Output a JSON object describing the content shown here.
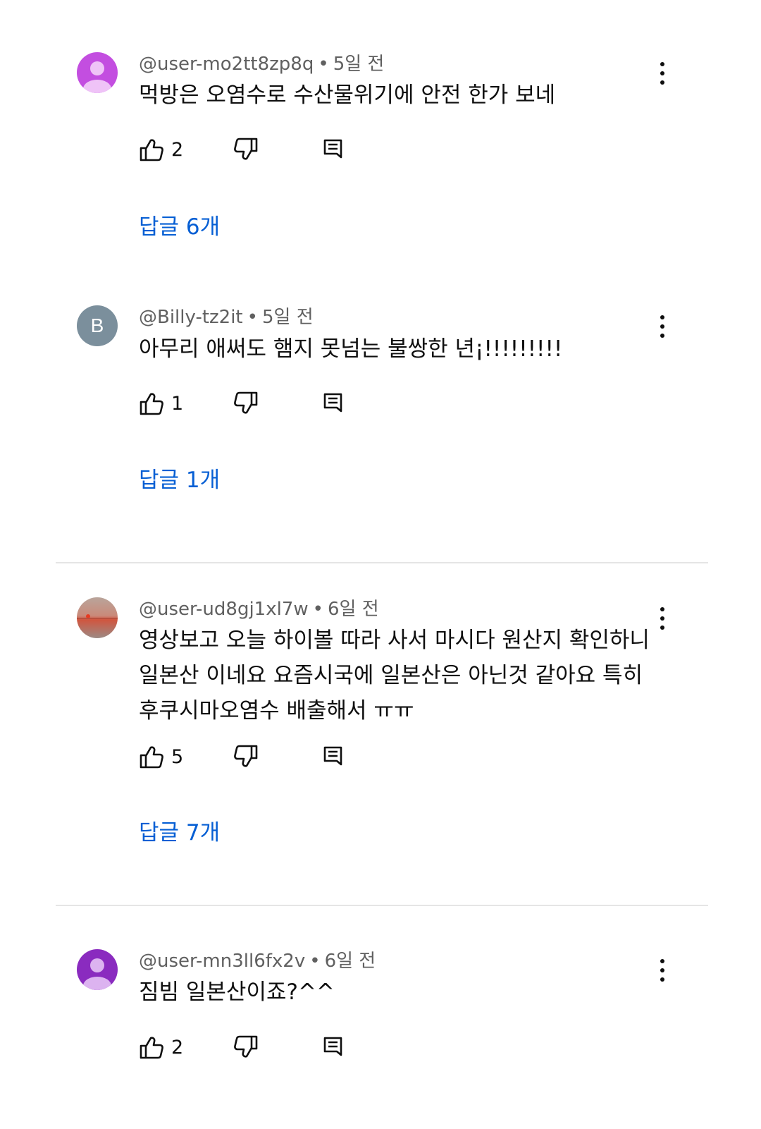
{
  "comments": [
    {
      "author": "@user-mo2tt8zp8q",
      "time": "5일 전",
      "text": "먹방은 오염수로 수산물위기에 안전 한가 보네",
      "likes": "2",
      "replies": "답글 6개",
      "avatar_color": "#c34ee0"
    },
    {
      "author": "@Billy-tz2it",
      "time": "5일 전",
      "text": "아무리 애써도 햄지 못넘는 불쌍한 년¡!!!!!!!!!",
      "likes": "1",
      "replies": "답글 1개",
      "avatar_letter": "B",
      "avatar_color": "#7b8f9c"
    },
    {
      "author": "@user-ud8gj1xl7w",
      "time": "6일 전",
      "text_lines": [
        "영상보고 오늘 하이볼 따라 사서 마시다 원산지 확인하니",
        "일본산 이네요 요즘시국에 일본산은 아닌것 같아요 특히",
        "후쿠시마오염수 배출해서 ㅠㅠ"
      ],
      "likes": "5",
      "replies": "답글 7개"
    },
    {
      "author": "@user-mn3ll6fx2v",
      "time": "6일 전",
      "text": "짐빔 일본산이죠?^^",
      "likes": "2",
      "avatar_color": "#8a2bbf"
    }
  ],
  "separator": "•",
  "icons": {
    "like": "thumbs-up-icon",
    "dislike": "thumbs-down-icon",
    "reply": "comment-reply-icon",
    "more": "more-vertical-icon"
  },
  "colors": {
    "link_blue": "#065fd4",
    "meta_gray": "#606060",
    "text": "#0f0f0f"
  }
}
